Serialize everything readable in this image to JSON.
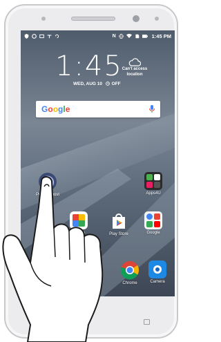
{
  "status_bar": {
    "time": "1:45 PM",
    "network": "N",
    "left_icons": [
      "shield-icon",
      "circle-icon",
      "notification-icon",
      "wifi-small-icon",
      "sync-icon"
    ],
    "right_icons": [
      "nfc-icon",
      "vibrate-icon",
      "wifi-icon",
      "no-sim-icon",
      "battery-icon"
    ]
  },
  "lock_widget": {
    "clock": "1:45",
    "date": "WED, AUG 10",
    "alarm": "OFF",
    "weather_text": "Can't access location"
  },
  "search_bar": {
    "logo_letters": [
      "G",
      "o",
      "o",
      "g",
      "l",
      "e"
    ],
    "mic_icon": "mic-icon"
  },
  "apps": {
    "power_boost": "Power Boost",
    "apps4u": "Apps4U",
    "play_store": "Play Store",
    "google": "Google",
    "chrome": "Chrome",
    "camera": "Camera",
    "photos": "Photos"
  },
  "colors": {
    "accent_blue": "#4285f4",
    "play_orange": "#f4b400",
    "chrome_red": "#db4437",
    "camera_blue": "#1e88e5"
  }
}
